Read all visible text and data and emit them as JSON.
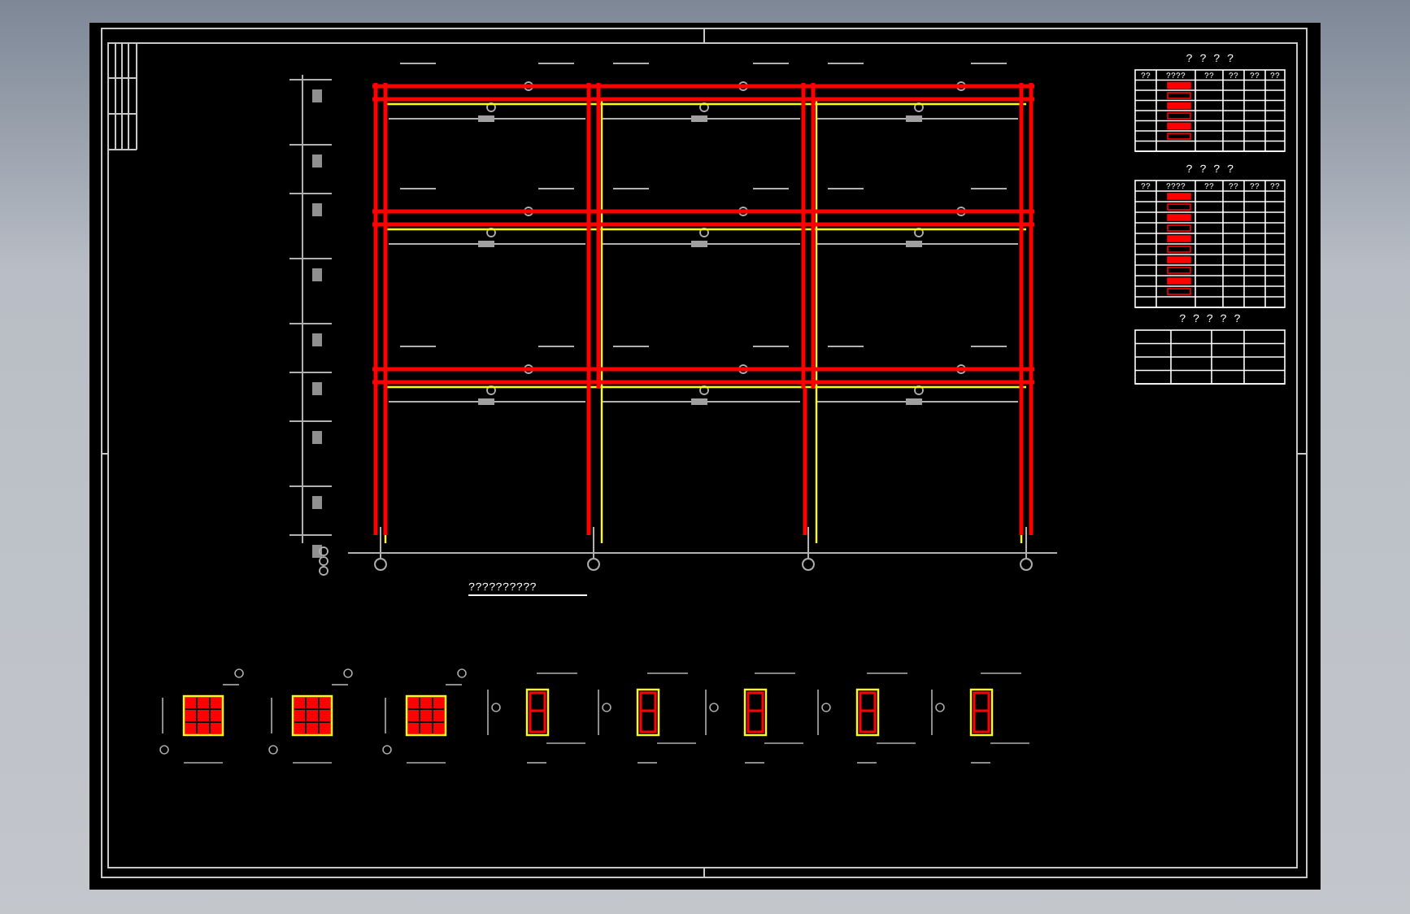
{
  "drawing": {
    "title": "??????????",
    "tables": [
      {
        "title": "? ? ? ?",
        "header": [
          "??",
          "????",
          "??",
          "??",
          "??",
          "??"
        ]
      },
      {
        "title": "? ? ? ?",
        "header": [
          "??",
          "????",
          "??",
          "??",
          "??",
          "??"
        ]
      },
      {
        "title": "? ? ? ? ?"
      }
    ]
  }
}
